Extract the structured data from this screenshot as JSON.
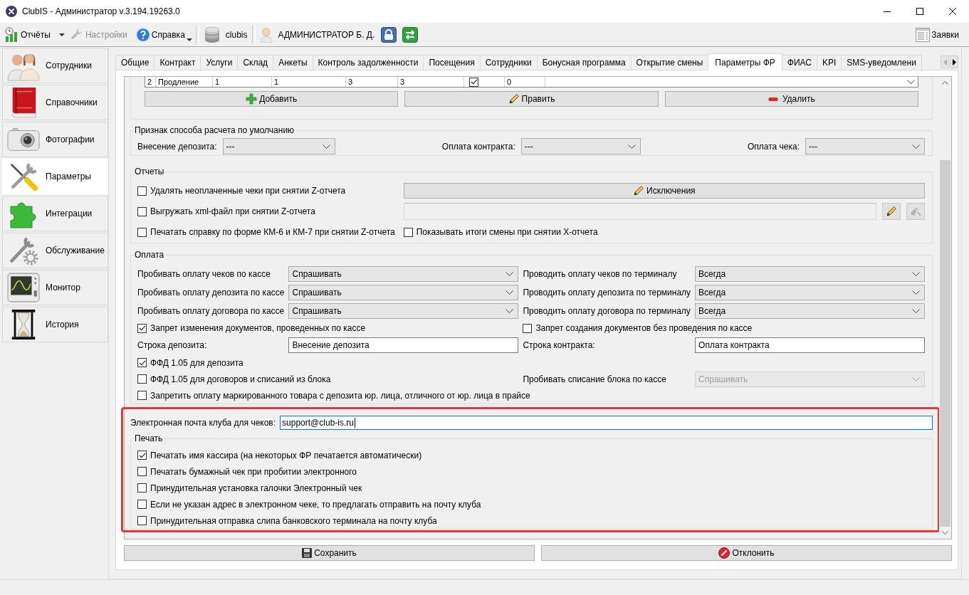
{
  "window": {
    "title": "ClubIS - Администратор v.3.194.19263.0"
  },
  "toolbar": {
    "reports": {
      "label": "Отчёты"
    },
    "settings": {
      "label": "Настройки",
      "disabled": true
    },
    "help": {
      "label": "Справка"
    },
    "database": {
      "label": "clubis"
    },
    "user": {
      "label": "АДМИНИСТРАТОР Б. Д."
    },
    "requests": {
      "label": "Заявки"
    }
  },
  "sidebar": {
    "items": [
      {
        "label": "Сотрудники",
        "selected": false
      },
      {
        "label": "Справочники",
        "selected": false
      },
      {
        "label": "Фотографии",
        "selected": false
      },
      {
        "label": "Параметры",
        "selected": true
      },
      {
        "label": "Интеграции",
        "selected": false
      },
      {
        "label": "Обслуживание",
        "selected": false
      },
      {
        "label": "Монитор",
        "selected": false
      },
      {
        "label": "История",
        "selected": false
      }
    ]
  },
  "tabs": [
    {
      "label": "Общие",
      "selected": false
    },
    {
      "label": "Контракт",
      "selected": false
    },
    {
      "label": "Услуги",
      "selected": false
    },
    {
      "label": "Склад",
      "selected": false
    },
    {
      "label": "Анкеты",
      "selected": false
    },
    {
      "label": "Контроль задолженности",
      "selected": false
    },
    {
      "label": "Посещения",
      "selected": false
    },
    {
      "label": "Сотрудники",
      "selected": false
    },
    {
      "label": "Бонусная программа",
      "selected": false
    },
    {
      "label": "Открытие смены",
      "selected": false
    },
    {
      "label": "Параметры ФР",
      "selected": true
    },
    {
      "label": "ФИАС",
      "selected": false
    },
    {
      "label": "KPI",
      "selected": false
    },
    {
      "label": "SMS-уведомлени",
      "selected": false
    }
  ],
  "table": {
    "rows": [
      {
        "cells": [
          {
            "kind": "text",
            "text": "2"
          },
          {
            "kind": "text",
            "text": "Продление"
          },
          {
            "kind": "text",
            "text": "1"
          },
          {
            "kind": "text",
            "text": "1"
          },
          {
            "kind": "text",
            "text": "3"
          },
          {
            "kind": "text",
            "text": "3"
          },
          {
            "kind": "check",
            "checked": true
          },
          {
            "kind": "text",
            "text": "0"
          }
        ]
      }
    ]
  },
  "table_buttons": [
    "Добавить",
    "Править",
    "Удалить"
  ],
  "default_method": {
    "title": "Признак способа расчета по умолчанию",
    "fields": [
      {
        "label": "Внесение депозита:",
        "value": "---"
      },
      {
        "label": "Оплата контракта:",
        "value": "---"
      },
      {
        "label": "Оплата чека:",
        "value": "---"
      }
    ]
  },
  "reports": {
    "title": "Отчеты",
    "items": [
      {
        "kind": "checkbox",
        "label": "Удалять неоплаченные чеки при снятии Z-отчета",
        "checked": false
      },
      {
        "kind": "button",
        "label": "Исключения"
      },
      {
        "kind": "checkbox",
        "label": "Выгружать xml-файл при снятии Z-отчета",
        "checked": false
      },
      {
        "kind": "path",
        "disabled": true
      },
      {
        "kind": "checkbox",
        "label": "Печатать справку по форме КМ-6 и КМ-7 при снятии Z-отчета",
        "checked": false
      },
      {
        "kind": "checkbox",
        "label": "Показывать итоги смены при снятии X-отчета",
        "checked": false
      }
    ]
  },
  "payment": {
    "title": "Оплата",
    "rows": [
      [
        {
          "kind": "select",
          "label": "Пробивать оплату чеков по кассе",
          "value": "Спрашивать",
          "disabled": false
        },
        {
          "kind": "select",
          "label": "Проводить оплату чеков по терминалу",
          "value": "Всегда",
          "disabled": false
        }
      ],
      [
        {
          "kind": "select",
          "label": "Пробивать оплату депозита по кассе",
          "value": "Спрашивать",
          "disabled": false
        },
        {
          "kind": "select",
          "label": "Проводить оплату депозита по терминалу",
          "value": "Всегда",
          "disabled": false
        }
      ],
      [
        {
          "kind": "select",
          "label": "Пробивать оплату договора по кассе",
          "value": "Спрашивать",
          "disabled": false
        },
        {
          "kind": "select",
          "label": "Проводить оплату договора по терминалу",
          "value": "Всегда",
          "disabled": false
        }
      ],
      [
        {
          "kind": "checkbox",
          "label": "Запрет изменения документов, проведенных по кассе",
          "checked": true
        },
        {
          "kind": "checkbox",
          "label": "Запрет создания документов без проведения по кассе",
          "checked": false
        }
      ],
      [
        {
          "kind": "text",
          "label": "Строка депозита:",
          "value": "Внесение депозита"
        },
        {
          "kind": "text",
          "label": "Строка контракта:",
          "value": "Оплата контракта"
        }
      ],
      [
        {
          "kind": "checkbox",
          "label": "ФФД 1.05 для депозита",
          "checked": true
        }
      ],
      [
        {
          "kind": "checkbox",
          "label": "ФФД 1.05 для договоров и списаний из блока",
          "checked": false
        },
        {
          "kind": "select",
          "label": "Пробивать списание блока по кассе",
          "value": "Спрашивать",
          "disabled": true
        }
      ],
      [
        {
          "kind": "checkbox",
          "label": "Запретить оплату маркированного товара с депозита юр. лица, отличного от юр. лица в прайсе",
          "checked": false
        }
      ]
    ]
  },
  "receipt": {
    "highlighted": true,
    "email": {
      "label": "Электронная почта клуба для чеков:",
      "value": "support@club-is.ru",
      "focused": true
    },
    "print": {
      "title": "Печать",
      "items": [
        {
          "label": "Печатать имя кассира (на некоторых ФР печатается автоматически)",
          "checked": true
        },
        {
          "label": "Печатать бумажный чек при пробитии электронного",
          "checked": false
        },
        {
          "label": "Принудительная установка галочки Электронный чек",
          "checked": false
        },
        {
          "label": "Если не указан адрес в электронном чеке, то предлагать отправить на почту клуба",
          "checked": false
        },
        {
          "label": "Принудительная отправка слипа банковского терминала на почту клуба",
          "checked": false
        }
      ]
    }
  },
  "footer_buttons": [
    "Сохранить",
    "Отклонить"
  ]
}
